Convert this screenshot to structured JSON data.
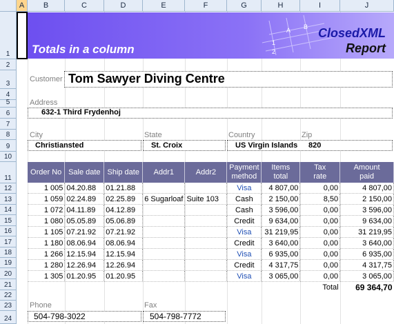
{
  "columns": [
    "A",
    "B",
    "C",
    "D",
    "E",
    "F",
    "G",
    "H",
    "I",
    "J"
  ],
  "rows": [
    "1",
    "2",
    "3",
    "4",
    "5",
    "6",
    "7",
    "8",
    "9",
    "10",
    "11",
    "12",
    "13",
    "14",
    "15",
    "16",
    "17",
    "18",
    "19",
    "20",
    "21",
    "22",
    "23",
    "24"
  ],
  "banner": {
    "title": "Totals in a column",
    "logo_line1": "ClosedXML",
    "logo_line2": "Report"
  },
  "customer": {
    "label": "Customer",
    "value": "Tom Sawyer Diving Centre"
  },
  "address": {
    "label": "Address",
    "value": "632-1 Third Frydenhoj"
  },
  "city": {
    "label": "City",
    "value": "Christiansted"
  },
  "state": {
    "label": "State",
    "value": "St. Croix"
  },
  "country": {
    "label": "Country",
    "value": "US Virgin Islands"
  },
  "zip": {
    "label": "Zip",
    "value": "820"
  },
  "table": {
    "headers": [
      [
        "Order No"
      ],
      [
        "Sale date"
      ],
      [
        "Ship date"
      ],
      [
        "Addr1"
      ],
      [
        "Addr2"
      ],
      [
        "Payment",
        "method"
      ],
      [
        "Items",
        "total"
      ],
      [
        "Tax",
        "rate"
      ],
      [
        "Amount",
        "paid"
      ]
    ],
    "rows": [
      [
        "1 005",
        "04.20.88",
        "01.21.88",
        "",
        "",
        "Visa",
        "4 807,00",
        "0,00",
        "4 807,00"
      ],
      [
        "1 059",
        "02.24.89",
        "02.25.89",
        "6 Sugarloaf",
        "Suite 103",
        "Cash",
        "2 150,00",
        "8,50",
        "2 150,00"
      ],
      [
        "1 072",
        "04.11.89",
        "04.12.89",
        "",
        "",
        "Cash",
        "3 596,00",
        "0,00",
        "3 596,00"
      ],
      [
        "1 080",
        "05.05.89",
        "05.06.89",
        "",
        "",
        "Credit",
        "9 634,00",
        "0,00",
        "9 634,00"
      ],
      [
        "1 105",
        "07.21.92",
        "07.21.92",
        "",
        "",
        "Visa",
        "31 219,95",
        "0,00",
        "31 219,95"
      ],
      [
        "1 180",
        "08.06.94",
        "08.06.94",
        "",
        "",
        "Credit",
        "3 640,00",
        "0,00",
        "3 640,00"
      ],
      [
        "1 266",
        "12.15.94",
        "12.15.94",
        "",
        "",
        "Visa",
        "6 935,00",
        "0,00",
        "6 935,00"
      ],
      [
        "1 280",
        "12.26.94",
        "12.26.94",
        "",
        "",
        "Credit",
        "4 317,75",
        "0,00",
        "4 317,75"
      ],
      [
        "1 305",
        "01.20.95",
        "01.20.95",
        "",
        "",
        "Visa",
        "3 065,00",
        "0,00",
        "3 065,00"
      ]
    ],
    "total_label": "Total",
    "total_value": "69 364,70"
  },
  "phone": {
    "label": "Phone",
    "value": "504-798-3022"
  },
  "fax": {
    "label": "Fax",
    "value": "504-798-7772"
  },
  "colors": {
    "banner": "#7a5ff3",
    "header_fill": "#6b6b9a",
    "visa": "#1f4fb5",
    "selected_col": "#ffd58d"
  }
}
